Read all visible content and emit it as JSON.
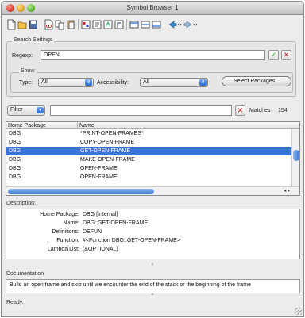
{
  "window": {
    "title": "Symbol Browser 1"
  },
  "toolbar": {
    "icons": [
      "new-icon",
      "open-icon",
      "save-icon",
      "cut-icon",
      "copy-icon",
      "paste-icon",
      "inspect-icon",
      "browse-icon",
      "class-icon",
      "function-icon",
      "describe-icon",
      "trace-icon",
      "step-icon",
      "back-icon",
      "forward-icon"
    ]
  },
  "search": {
    "legend": "Search Settings",
    "regexp_label": "Regexp:",
    "regexp_value": "OPEN",
    "show_legend": "Show",
    "type_label": "Type:",
    "type_value": "All",
    "access_label": "Accessibility:",
    "access_value": "All",
    "select_packages": "Select Packages..."
  },
  "filter": {
    "label": "Filter",
    "value": "",
    "matches_label": "Matches",
    "matches_count": "154"
  },
  "table": {
    "columns": [
      "Home Package",
      "Name"
    ],
    "rows": [
      {
        "package": "DBG",
        "name": "*PRINT-OPEN-FRAMES*",
        "selected": false
      },
      {
        "package": "DBG",
        "name": "COPY-OPEN-FRAME",
        "selected": false
      },
      {
        "package": "DBG",
        "name": "GET-OPEN-FRAME",
        "selected": true
      },
      {
        "package": "DBG",
        "name": "MAKE-OPEN-FRAME",
        "selected": false
      },
      {
        "package": "DBG",
        "name": "OPEN-FRAME",
        "selected": false
      },
      {
        "package": "DBG",
        "name": "OPEN-FRAME",
        "selected": false
      }
    ]
  },
  "description": {
    "title": "Description:",
    "fields": [
      {
        "key": "Home Package:",
        "value": "DBG [Internal]"
      },
      {
        "key": "Name:",
        "value": "DBG::GET-OPEN-FRAME"
      },
      {
        "key": "Definitions:",
        "value": "DEFUN"
      },
      {
        "key": "Function:",
        "value": "#<Function DBG::GET-OPEN-FRAME>"
      },
      {
        "key": "Lambda List:",
        "value": "(&OPTIONAL)"
      }
    ]
  },
  "documentation": {
    "title": "Documentation",
    "text": "Build an open frame and skip until we encounter the end of the stack or the beginning of the frame"
  },
  "status": {
    "text": "Ready."
  },
  "colors": {
    "selection": "#3875d7",
    "accent": "#2a6ad2"
  }
}
